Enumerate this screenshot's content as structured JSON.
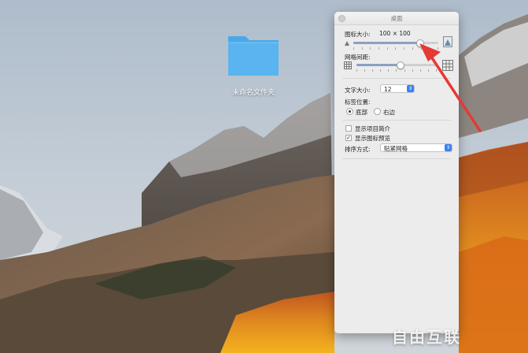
{
  "desktop": {
    "folder_label": "未命名文件夹"
  },
  "panel": {
    "title": "桌面",
    "icon_size_label": "图标大小:",
    "icon_size_value": "100 × 100",
    "icon_size_fraction": 0.79,
    "grid_spacing_label": "网格间距:",
    "grid_spacing_fraction": 0.55,
    "text_size_label": "文字大小:",
    "text_size_value": "12",
    "label_position_label": "标签位置:",
    "label_bottom": "底部",
    "label_right": "右边",
    "show_item_info": "显示项目简介",
    "show_icon_preview": "显示图标预览",
    "sort_by_label": "排序方式:",
    "sort_by_value": "贴紧网格"
  },
  "watermark": "自由互联",
  "colors": {
    "accent": "#3b82f0",
    "arrow_red": "#e53935",
    "folder_blue": "#5ab4f0"
  }
}
